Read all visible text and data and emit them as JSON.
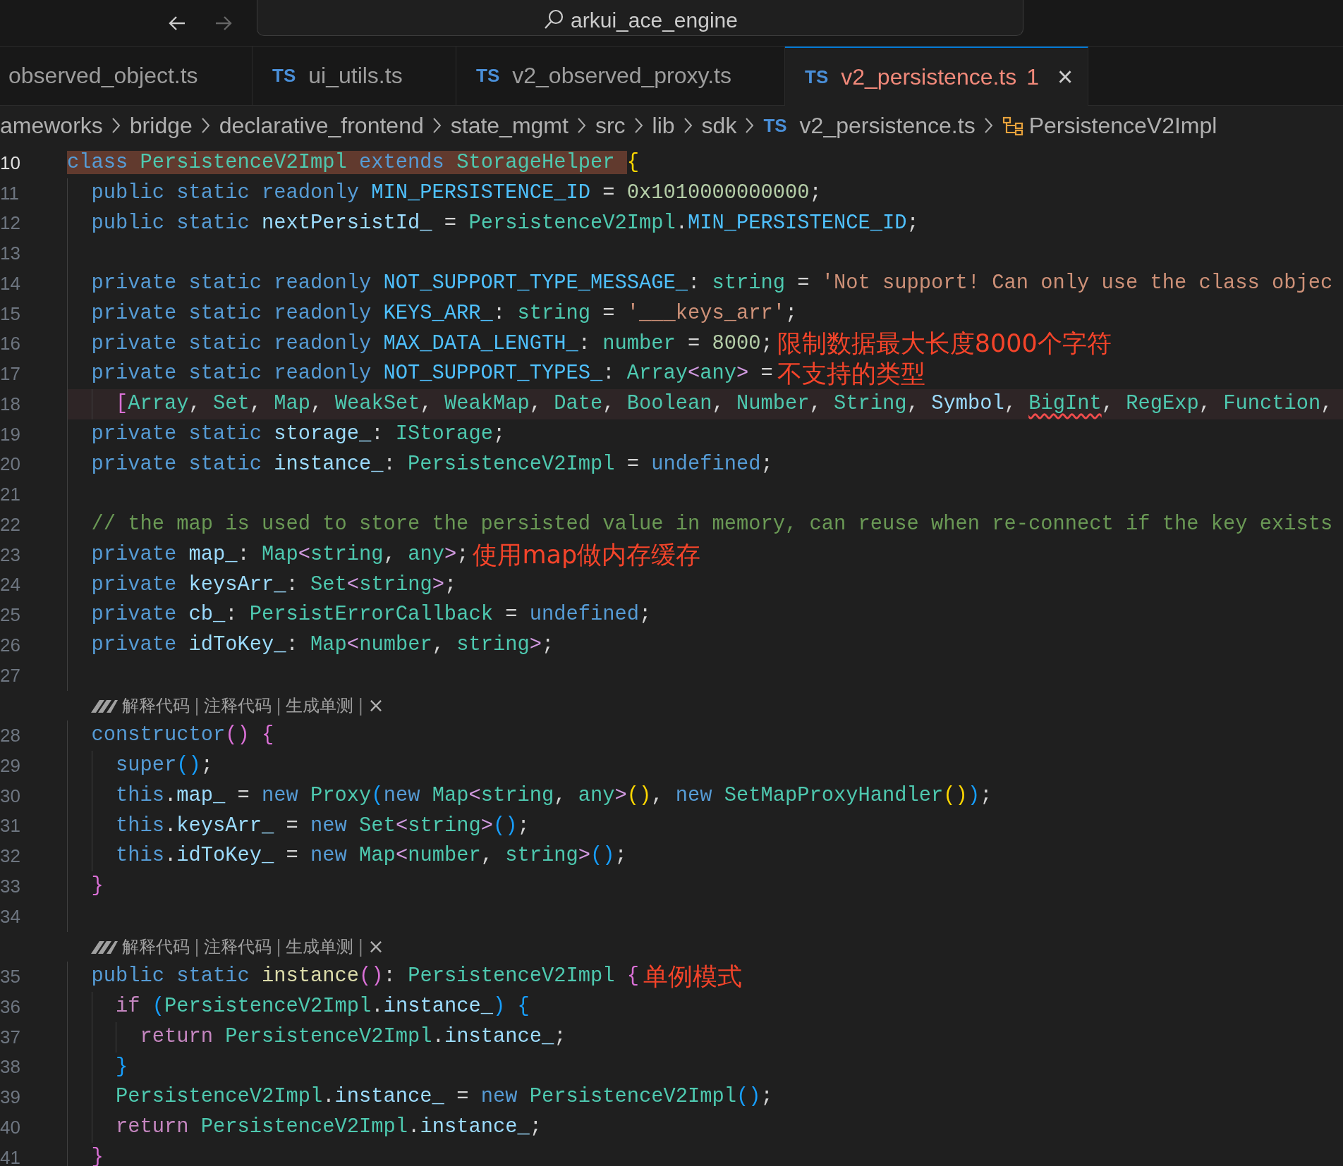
{
  "title_bar": {
    "back_enabled": true,
    "forward_enabled": false,
    "search": {
      "value": "arkui_ace_engine"
    }
  },
  "tabs": [
    {
      "label": "observed_object.ts",
      "selected": false
    },
    {
      "label": "ui_utils.ts",
      "badge": "TS",
      "selected": false
    },
    {
      "label": "v2_observed_proxy.ts",
      "badge": "TS",
      "selected": false
    },
    {
      "label": "v2_persistence.ts",
      "badge": "TS",
      "selected": true,
      "problems": "1",
      "close": "×"
    }
  ],
  "breadcrumb": [
    {
      "kind": "folder",
      "text": "ameworks"
    },
    {
      "kind": "folder",
      "text": "bridge"
    },
    {
      "kind": "folder",
      "text": "declarative_frontend"
    },
    {
      "kind": "folder",
      "text": "state_mgmt"
    },
    {
      "kind": "folder",
      "text": "src"
    },
    {
      "kind": "folder",
      "text": "lib"
    },
    {
      "kind": "folder",
      "text": "sdk"
    },
    {
      "kind": "file",
      "badge": "TS",
      "text": "v2_persistence.ts"
    },
    {
      "kind": "class",
      "text": "PersistenceV2Impl"
    }
  ],
  "editor": {
    "rows": [
      {
        "kind": "code",
        "number": "10",
        "current": true,
        "highlighted": false,
        "indent": "",
        "tokens": [
          {
            "kind": "kw",
            "text": "class ",
            "marked": true
          },
          {
            "kind": "type",
            "text": "PersistenceV2Impl",
            "marked": true
          },
          {
            "kind": "kw",
            "text": " extends ",
            "marked": true
          },
          {
            "kind": "type",
            "text": "StorageHelper ",
            "marked": true
          },
          {
            "kind": "b1",
            "text": "{"
          }
        ]
      },
      {
        "kind": "code",
        "number": "11",
        "current": false,
        "highlighted": false,
        "indent": "  ",
        "tokens": [
          {
            "kind": "kw",
            "text": "public static readonly "
          },
          {
            "kind": "const",
            "text": "MIN_PERSISTENCE_ID"
          },
          {
            "kind": "p",
            "text": " = "
          },
          {
            "kind": "num",
            "text": "0x1010000000000"
          },
          {
            "kind": "p",
            "text": ";"
          }
        ]
      },
      {
        "kind": "code",
        "number": "12",
        "current": false,
        "highlighted": false,
        "indent": "  ",
        "tokens": [
          {
            "kind": "kw",
            "text": "public static "
          },
          {
            "kind": "prop",
            "text": "nextPersistId_"
          },
          {
            "kind": "p",
            "text": " = "
          },
          {
            "kind": "type",
            "text": "PersistenceV2Impl"
          },
          {
            "kind": "p",
            "text": "."
          },
          {
            "kind": "const",
            "text": "MIN_PERSISTENCE_ID"
          },
          {
            "kind": "p",
            "text": ";"
          }
        ]
      },
      {
        "kind": "code",
        "number": "13",
        "current": false,
        "highlighted": false,
        "indent": "  ",
        "tokens": []
      },
      {
        "kind": "code",
        "number": "14",
        "current": false,
        "highlighted": false,
        "indent": "  ",
        "tokens": [
          {
            "kind": "kw",
            "text": "private static readonly "
          },
          {
            "kind": "const",
            "text": "NOT_SUPPORT_TYPE_MESSAGE_"
          },
          {
            "kind": "p",
            "text": ": "
          },
          {
            "kind": "type",
            "text": "string"
          },
          {
            "kind": "p",
            "text": " = "
          },
          {
            "kind": "str",
            "text": "'Not support! Can only use the class objec"
          }
        ]
      },
      {
        "kind": "code",
        "number": "15",
        "current": false,
        "highlighted": false,
        "indent": "  ",
        "tokens": [
          {
            "kind": "kw",
            "text": "private static readonly "
          },
          {
            "kind": "const",
            "text": "KEYS_ARR_"
          },
          {
            "kind": "p",
            "text": ": "
          },
          {
            "kind": "type",
            "text": "string"
          },
          {
            "kind": "p",
            "text": " = "
          },
          {
            "kind": "str",
            "text": "'___keys_arr'"
          },
          {
            "kind": "p",
            "text": ";"
          }
        ]
      },
      {
        "kind": "code",
        "number": "16",
        "current": false,
        "highlighted": false,
        "indent": "  ",
        "tokens": [
          {
            "kind": "kw",
            "text": "private static readonly "
          },
          {
            "kind": "const",
            "text": "MAX_DATA_LENGTH_"
          },
          {
            "kind": "p",
            "text": ": "
          },
          {
            "kind": "type",
            "text": "number"
          },
          {
            "kind": "p",
            "text": " = "
          },
          {
            "kind": "num",
            "text": "8000"
          },
          {
            "kind": "p",
            "text": ";"
          }
        ],
        "note": "限制数据最大长度8000个字符"
      },
      {
        "kind": "code",
        "number": "17",
        "current": false,
        "highlighted": false,
        "indent": "  ",
        "tokens": [
          {
            "kind": "kw",
            "text": "private static readonly "
          },
          {
            "kind": "const",
            "text": "NOT_SUPPORT_TYPES_"
          },
          {
            "kind": "p",
            "text": ": "
          },
          {
            "kind": "type",
            "text": "Array"
          },
          {
            "kind": "angle",
            "text": "<"
          },
          {
            "kind": "type",
            "text": "any"
          },
          {
            "kind": "angle",
            "text": ">"
          },
          {
            "kind": "p",
            "text": " ="
          }
        ],
        "note": "不支持的类型"
      },
      {
        "kind": "code",
        "number": "18",
        "current": false,
        "highlighted": true,
        "indent": "    ",
        "tokens": [
          {
            "kind": "b2",
            "text": "["
          },
          {
            "kind": "type",
            "text": "Array"
          },
          {
            "kind": "p",
            "text": ", "
          },
          {
            "kind": "type",
            "text": "Set"
          },
          {
            "kind": "p",
            "text": ", "
          },
          {
            "kind": "type",
            "text": "Map"
          },
          {
            "kind": "p",
            "text": ", "
          },
          {
            "kind": "type",
            "text": "WeakSet"
          },
          {
            "kind": "p",
            "text": ", "
          },
          {
            "kind": "type",
            "text": "WeakMap"
          },
          {
            "kind": "p",
            "text": ", "
          },
          {
            "kind": "type",
            "text": "Date"
          },
          {
            "kind": "p",
            "text": ", "
          },
          {
            "kind": "type",
            "text": "Boolean"
          },
          {
            "kind": "p",
            "text": ", "
          },
          {
            "kind": "type",
            "text": "Number"
          },
          {
            "kind": "p",
            "text": ", "
          },
          {
            "kind": "type",
            "text": "String"
          },
          {
            "kind": "p",
            "text": ", "
          },
          {
            "kind": "prop",
            "text": "Symbol"
          },
          {
            "kind": "p",
            "text": ", "
          },
          {
            "kind": "type_err",
            "text": "BigInt"
          },
          {
            "kind": "p",
            "text": ", "
          },
          {
            "kind": "type",
            "text": "RegExp"
          },
          {
            "kind": "p",
            "text": ", "
          },
          {
            "kind": "type",
            "text": "Function"
          },
          {
            "kind": "p",
            "text": ","
          }
        ]
      },
      {
        "kind": "code",
        "number": "19",
        "current": false,
        "highlighted": false,
        "indent": "  ",
        "tokens": [
          {
            "kind": "kw",
            "text": "private static "
          },
          {
            "kind": "prop",
            "text": "storage_"
          },
          {
            "kind": "p",
            "text": ": "
          },
          {
            "kind": "type",
            "text": "IStorage"
          },
          {
            "kind": "p",
            "text": ";"
          }
        ]
      },
      {
        "kind": "code",
        "number": "20",
        "current": false,
        "highlighted": false,
        "indent": "  ",
        "tokens": [
          {
            "kind": "kw",
            "text": "private static "
          },
          {
            "kind": "prop",
            "text": "instance_"
          },
          {
            "kind": "p",
            "text": ": "
          },
          {
            "kind": "type",
            "text": "PersistenceV2Impl"
          },
          {
            "kind": "p",
            "text": " = "
          },
          {
            "kind": "kw",
            "text": "undefined"
          },
          {
            "kind": "p",
            "text": ";"
          }
        ]
      },
      {
        "kind": "code",
        "number": "21",
        "current": false,
        "highlighted": false,
        "indent": "  ",
        "tokens": []
      },
      {
        "kind": "code",
        "number": "22",
        "current": false,
        "highlighted": false,
        "indent": "  ",
        "tokens": [
          {
            "kind": "comment",
            "text": "// the map is used to store the persisted value in memory, can reuse when re-connect if the key exists"
          }
        ]
      },
      {
        "kind": "code",
        "number": "23",
        "current": false,
        "highlighted": false,
        "indent": "  ",
        "tokens": [
          {
            "kind": "kw",
            "text": "private "
          },
          {
            "kind": "prop",
            "text": "map_"
          },
          {
            "kind": "p",
            "text": ": "
          },
          {
            "kind": "type",
            "text": "Map"
          },
          {
            "kind": "angle",
            "text": "<"
          },
          {
            "kind": "type",
            "text": "string"
          },
          {
            "kind": "p",
            "text": ", "
          },
          {
            "kind": "type",
            "text": "any"
          },
          {
            "kind": "angle",
            "text": ">"
          },
          {
            "kind": "p",
            "text": ";"
          }
        ],
        "note": "使用map做内存缓存"
      },
      {
        "kind": "code",
        "number": "24",
        "current": false,
        "highlighted": false,
        "indent": "  ",
        "tokens": [
          {
            "kind": "kw",
            "text": "private "
          },
          {
            "kind": "prop",
            "text": "keysArr_"
          },
          {
            "kind": "p",
            "text": ": "
          },
          {
            "kind": "type",
            "text": "Set"
          },
          {
            "kind": "angle",
            "text": "<"
          },
          {
            "kind": "type",
            "text": "string"
          },
          {
            "kind": "angle",
            "text": ">"
          },
          {
            "kind": "p",
            "text": ";"
          }
        ]
      },
      {
        "kind": "code",
        "number": "25",
        "current": false,
        "highlighted": false,
        "indent": "  ",
        "tokens": [
          {
            "kind": "kw",
            "text": "private "
          },
          {
            "kind": "prop",
            "text": "cb_"
          },
          {
            "kind": "p",
            "text": ": "
          },
          {
            "kind": "type",
            "text": "PersistErrorCallback"
          },
          {
            "kind": "p",
            "text": " = "
          },
          {
            "kind": "kw",
            "text": "undefined"
          },
          {
            "kind": "p",
            "text": ";"
          }
        ]
      },
      {
        "kind": "code",
        "number": "26",
        "current": false,
        "highlighted": false,
        "indent": "  ",
        "tokens": [
          {
            "kind": "kw",
            "text": "private "
          },
          {
            "kind": "prop",
            "text": "idToKey_"
          },
          {
            "kind": "p",
            "text": ": "
          },
          {
            "kind": "type",
            "text": "Map"
          },
          {
            "kind": "angle",
            "text": "<"
          },
          {
            "kind": "type",
            "text": "number"
          },
          {
            "kind": "p",
            "text": ", "
          },
          {
            "kind": "type",
            "text": "string"
          },
          {
            "kind": "angle",
            "text": ">"
          },
          {
            "kind": "p",
            "text": ";"
          }
        ]
      },
      {
        "kind": "code",
        "number": "27",
        "current": false,
        "highlighted": false,
        "indent": "  ",
        "tokens": []
      },
      {
        "kind": "lens",
        "items": [
          {
            "kind": "action",
            "text": "解释代码"
          },
          {
            "kind": "sep",
            "text": "|"
          },
          {
            "kind": "action",
            "text": "注释代码"
          },
          {
            "kind": "sep",
            "text": "|"
          },
          {
            "kind": "action",
            "text": "生成单测"
          },
          {
            "kind": "sep",
            "text": "|"
          },
          {
            "kind": "close",
            "text": "×"
          }
        ]
      },
      {
        "kind": "code",
        "number": "28",
        "current": false,
        "highlighted": false,
        "indent": "  ",
        "tokens": [
          {
            "kind": "kw",
            "text": "constructor"
          },
          {
            "kind": "b2",
            "text": "()"
          },
          {
            "kind": "b2",
            "text": " {"
          }
        ]
      },
      {
        "kind": "code",
        "number": "29",
        "current": false,
        "highlighted": false,
        "indent": "    ",
        "tokens": [
          {
            "kind": "kw",
            "text": "super"
          },
          {
            "kind": "b3",
            "text": "()"
          },
          {
            "kind": "p",
            "text": ";"
          }
        ]
      },
      {
        "kind": "code",
        "number": "30",
        "current": false,
        "highlighted": false,
        "indent": "    ",
        "tokens": [
          {
            "kind": "kw",
            "text": "this"
          },
          {
            "kind": "p",
            "text": "."
          },
          {
            "kind": "prop",
            "text": "map_"
          },
          {
            "kind": "p",
            "text": " = "
          },
          {
            "kind": "kw",
            "text": "new "
          },
          {
            "kind": "type",
            "text": "Proxy"
          },
          {
            "kind": "b3",
            "text": "("
          },
          {
            "kind": "kw",
            "text": "new "
          },
          {
            "kind": "type",
            "text": "Map"
          },
          {
            "kind": "angle",
            "text": "<"
          },
          {
            "kind": "type",
            "text": "string"
          },
          {
            "kind": "p",
            "text": ", "
          },
          {
            "kind": "type",
            "text": "any"
          },
          {
            "kind": "angle",
            "text": ">"
          },
          {
            "kind": "b1",
            "text": "()"
          },
          {
            "kind": "p",
            "text": ", "
          },
          {
            "kind": "kw",
            "text": "new "
          },
          {
            "kind": "type",
            "text": "SetMapProxyHandler"
          },
          {
            "kind": "b1",
            "text": "()"
          },
          {
            "kind": "b3",
            "text": ")"
          },
          {
            "kind": "p",
            "text": ";"
          }
        ]
      },
      {
        "kind": "code",
        "number": "31",
        "current": false,
        "highlighted": false,
        "indent": "    ",
        "tokens": [
          {
            "kind": "kw",
            "text": "this"
          },
          {
            "kind": "p",
            "text": "."
          },
          {
            "kind": "prop",
            "text": "keysArr_"
          },
          {
            "kind": "p",
            "text": " = "
          },
          {
            "kind": "kw",
            "text": "new "
          },
          {
            "kind": "type",
            "text": "Set"
          },
          {
            "kind": "angle",
            "text": "<"
          },
          {
            "kind": "type",
            "text": "string"
          },
          {
            "kind": "angle",
            "text": ">"
          },
          {
            "kind": "b3",
            "text": "()"
          },
          {
            "kind": "p",
            "text": ";"
          }
        ]
      },
      {
        "kind": "code",
        "number": "32",
        "current": false,
        "highlighted": false,
        "indent": "    ",
        "tokens": [
          {
            "kind": "kw",
            "text": "this"
          },
          {
            "kind": "p",
            "text": "."
          },
          {
            "kind": "prop",
            "text": "idToKey_"
          },
          {
            "kind": "p",
            "text": " = "
          },
          {
            "kind": "kw",
            "text": "new "
          },
          {
            "kind": "type",
            "text": "Map"
          },
          {
            "kind": "angle",
            "text": "<"
          },
          {
            "kind": "type",
            "text": "number"
          },
          {
            "kind": "p",
            "text": ", "
          },
          {
            "kind": "type",
            "text": "string"
          },
          {
            "kind": "angle",
            "text": ">"
          },
          {
            "kind": "b3",
            "text": "()"
          },
          {
            "kind": "p",
            "text": ";"
          }
        ]
      },
      {
        "kind": "code",
        "number": "33",
        "current": false,
        "highlighted": false,
        "indent": "  ",
        "tokens": [
          {
            "kind": "b2",
            "text": "}"
          }
        ]
      },
      {
        "kind": "code",
        "number": "34",
        "current": false,
        "highlighted": false,
        "indent": "  ",
        "tokens": []
      },
      {
        "kind": "lens",
        "items": [
          {
            "kind": "action",
            "text": "解释代码"
          },
          {
            "kind": "sep",
            "text": "|"
          },
          {
            "kind": "action",
            "text": "注释代码"
          },
          {
            "kind": "sep",
            "text": "|"
          },
          {
            "kind": "action",
            "text": "生成单测"
          },
          {
            "kind": "sep",
            "text": "|"
          },
          {
            "kind": "close",
            "text": "×"
          }
        ]
      },
      {
        "kind": "code",
        "number": "35",
        "current": false,
        "highlighted": false,
        "indent": "  ",
        "tokens": [
          {
            "kind": "kw",
            "text": "public static "
          },
          {
            "kind": "fn",
            "text": "instance"
          },
          {
            "kind": "b2",
            "text": "()"
          },
          {
            "kind": "p",
            "text": ": "
          },
          {
            "kind": "type",
            "text": "PersistenceV2Impl"
          },
          {
            "kind": "b2",
            "text": " {"
          }
        ],
        "note": "单例模式"
      },
      {
        "kind": "code",
        "number": "36",
        "current": false,
        "highlighted": false,
        "indent": "    ",
        "tokens": [
          {
            "kind": "ctrl",
            "text": "if "
          },
          {
            "kind": "b3",
            "text": "("
          },
          {
            "kind": "type",
            "text": "PersistenceV2Impl"
          },
          {
            "kind": "p",
            "text": "."
          },
          {
            "kind": "prop",
            "text": "instance_"
          },
          {
            "kind": "b3",
            "text": ")"
          },
          {
            "kind": "b3",
            "text": " {"
          }
        ]
      },
      {
        "kind": "code",
        "number": "37",
        "current": false,
        "highlighted": false,
        "indent": "      ",
        "tokens": [
          {
            "kind": "ctrl",
            "text": "return "
          },
          {
            "kind": "type",
            "text": "PersistenceV2Impl"
          },
          {
            "kind": "p",
            "text": "."
          },
          {
            "kind": "prop",
            "text": "instance_"
          },
          {
            "kind": "p",
            "text": ";"
          }
        ]
      },
      {
        "kind": "code",
        "number": "38",
        "current": false,
        "highlighted": false,
        "indent": "    ",
        "tokens": [
          {
            "kind": "b3",
            "text": "}"
          }
        ]
      },
      {
        "kind": "code",
        "number": "39",
        "current": false,
        "highlighted": false,
        "indent": "    ",
        "tokens": [
          {
            "kind": "type",
            "text": "PersistenceV2Impl"
          },
          {
            "kind": "p",
            "text": "."
          },
          {
            "kind": "prop",
            "text": "instance_"
          },
          {
            "kind": "p",
            "text": " = "
          },
          {
            "kind": "kw",
            "text": "new "
          },
          {
            "kind": "type",
            "text": "PersistenceV2Impl"
          },
          {
            "kind": "b3",
            "text": "()"
          },
          {
            "kind": "p",
            "text": ";"
          }
        ]
      },
      {
        "kind": "code",
        "number": "40",
        "current": false,
        "highlighted": false,
        "indent": "    ",
        "tokens": [
          {
            "kind": "ctrl",
            "text": "return "
          },
          {
            "kind": "type",
            "text": "PersistenceV2Impl"
          },
          {
            "kind": "p",
            "text": "."
          },
          {
            "kind": "prop",
            "text": "instance_"
          },
          {
            "kind": "p",
            "text": ";"
          }
        ]
      },
      {
        "kind": "code",
        "number": "41",
        "current": false,
        "highlighted": false,
        "indent": "  ",
        "tokens": [
          {
            "kind": "b2",
            "text": "}"
          }
        ]
      }
    ]
  }
}
